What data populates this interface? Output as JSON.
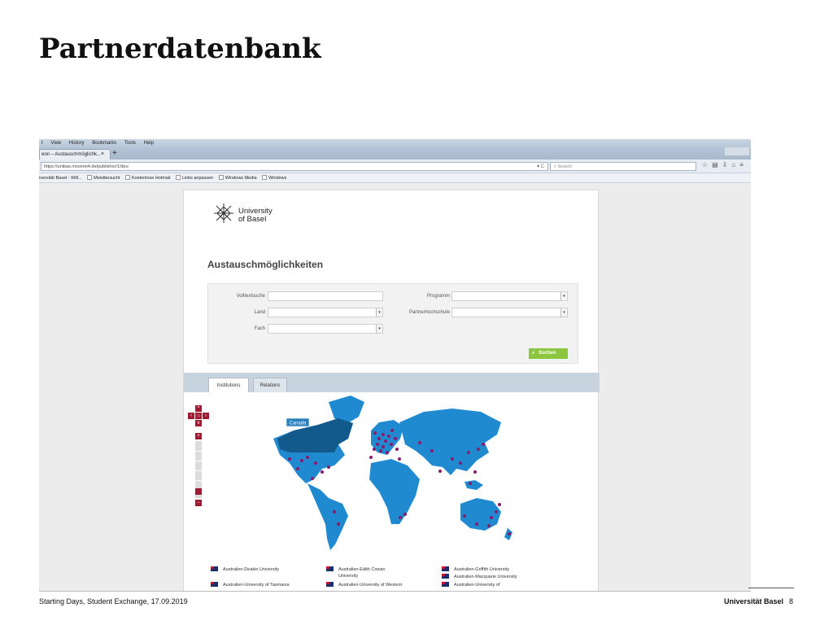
{
  "slide": {
    "title": "Partnerdatenbank",
    "footer_left": "Starting Days, Student Exchange, 17.09.2019",
    "footer_org": "Universität Basel",
    "page_number": "8"
  },
  "browser": {
    "menu": [
      "t",
      "View",
      "History",
      "Bookmarks",
      "Tools",
      "Help"
    ],
    "tab_title": "eon – Austauschmöglichk...",
    "tab_close": "×",
    "new_tab": "+",
    "url": "https://unibas.moveon4.de/publisher/1/deu",
    "search_placeholder": "Search",
    "bookmarks": [
      "iversität Basel - Will...",
      "Meistbesucht",
      "Kostenlose Hotmail",
      "Links anpassen",
      "Windows Media",
      "Windows"
    ]
  },
  "page": {
    "logo_text": "University\nof Basel",
    "heading": "Austauschmöglichkeiten",
    "form": {
      "fulltext_label": "Volltextsuche",
      "country_label": "Land",
      "subject_label": "Fach",
      "program_label": "Programm",
      "partner_label": "Partnerhochschule",
      "search_button": "Suchen"
    },
    "tabs": [
      "Institutions",
      "Relations"
    ],
    "map": {
      "tooltip": "Canada",
      "colors": {
        "ocean": "#ffffff",
        "land": "#1f8ad0",
        "highlight": "#135a8c",
        "marker": "#8a1a6a"
      }
    },
    "partners": [
      "Australien-Deakin University",
      "Australien-Edith Cowan",
      "University",
      "Australien-Griffith University",
      "Australien-Macquarie University",
      "Australien-University of Tasmania",
      "Australien-University of Western",
      "Australien-University of"
    ]
  }
}
